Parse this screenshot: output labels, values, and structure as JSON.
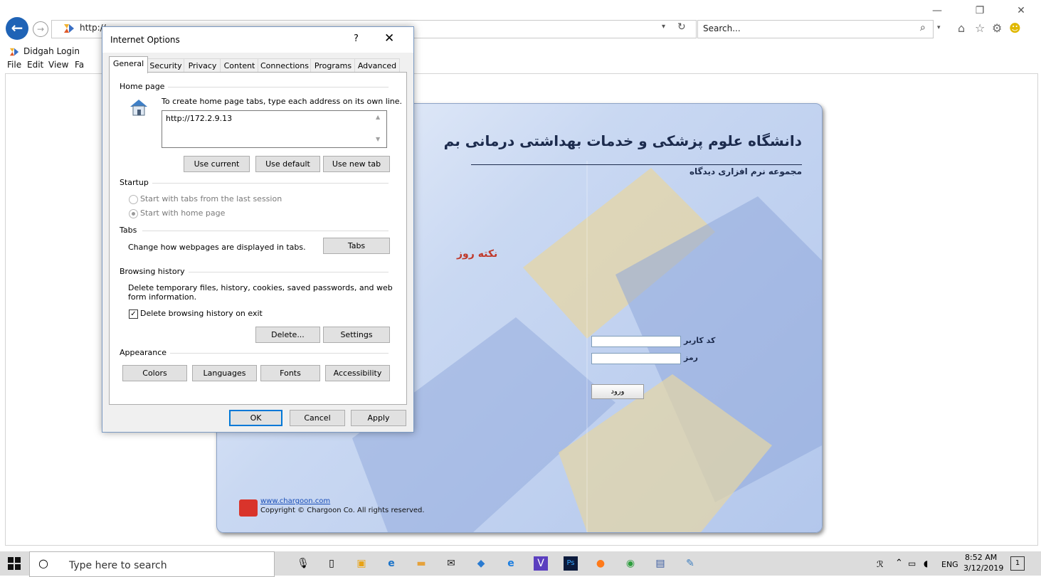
{
  "browser": {
    "address": "http://",
    "search_placeholder": "Search...",
    "tab_title": "Didgah Login",
    "menu": [
      "File",
      "Edit",
      "View",
      "Fa"
    ]
  },
  "page": {
    "university_title": "دانشگاه علوم پزشکی و خدمات بهداشتی درمانی بم",
    "suite_name": "مجموعه نرم افزاری دیدگاه",
    "tip_title": "نکته روز",
    "userid_label": "کد کاربر",
    "password_label": "رمز",
    "login_button": "ورود",
    "chargoon_link": "www.chargoon.com",
    "copyright": "Copyright © Chargoon Co. All rights reserved."
  },
  "dialog": {
    "title": "Internet Options",
    "help": "?",
    "close": "✕",
    "tabs": [
      "General",
      "Security",
      "Privacy",
      "Content",
      "Connections",
      "Programs",
      "Advanced"
    ],
    "home_page": {
      "group": "Home page",
      "instruction": "To create home page tabs, type each address on its own line.",
      "url": "http://172.2.9.13",
      "use_current": "Use current",
      "use_default": "Use default",
      "use_new_tab": "Use new tab"
    },
    "startup": {
      "group": "Startup",
      "option_last_session": "Start with tabs from the last session",
      "option_home_page": "Start with home page",
      "selected": "Start with home page"
    },
    "tabs_group": {
      "group": "Tabs",
      "description": "Change how webpages are displayed in tabs.",
      "button": "Tabs"
    },
    "browsing_history": {
      "group": "Browsing history",
      "description_line1": "Delete temporary files, history, cookies, saved passwords, and web",
      "description_line2": "form information.",
      "checkbox_label": "Delete browsing history on exit",
      "checkbox_checked": true,
      "delete": "Delete...",
      "settings": "Settings"
    },
    "appearance": {
      "group": "Appearance",
      "colors": "Colors",
      "languages": "Languages",
      "fonts": "Fonts",
      "accessibility": "Accessibility"
    },
    "ok": "OK",
    "cancel": "Cancel",
    "apply": "Apply"
  },
  "taskbar": {
    "search_placeholder": "Type here to search",
    "lang": "ENG",
    "time": "8:52 AM",
    "date": "3/12/2019",
    "notification_count": "1"
  },
  "icons": {
    "back": "back-arrow-icon",
    "forward": "forward-arrow-icon",
    "refresh": "refresh-icon",
    "home": "home-icon",
    "favorites": "star-icon",
    "tools": "gear-icon",
    "smiley": "smiley-icon"
  },
  "colors": {
    "accent": "#1f63b6",
    "title_text": "#1c2b4d",
    "tip_text": "#c0392b",
    "link": "#1a4fb8"
  }
}
